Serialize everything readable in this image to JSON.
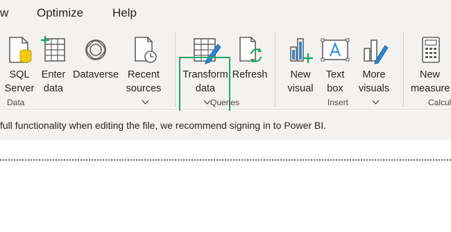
{
  "tabs": [
    "w",
    "Optimize",
    "Help"
  ],
  "ribbon": {
    "data_group": {
      "label": "Data",
      "buttons": [
        {
          "line1": "SQL",
          "line2": "Server",
          "icon": "sql-server-icon"
        },
        {
          "line1": "Enter",
          "line2": "data",
          "icon": "enter-data-icon"
        },
        {
          "line1": "Dataverse",
          "line2": "",
          "icon": "dataverse-icon"
        },
        {
          "line1": "Recent",
          "line2": "sources",
          "icon": "recent-sources-icon",
          "dropdown": true
        }
      ]
    },
    "queries_group": {
      "label": "Queries",
      "buttons": [
        {
          "line1": "Transform",
          "line2": "data",
          "icon": "transform-data-icon",
          "dropdown": true
        },
        {
          "line1": "Refresh",
          "line2": "",
          "icon": "refresh-icon"
        }
      ]
    },
    "insert_group": {
      "label": "Insert",
      "buttons": [
        {
          "line1": "New",
          "line2": "visual",
          "icon": "new-visual-icon"
        },
        {
          "line1": "Text",
          "line2": "box",
          "icon": "text-box-icon"
        },
        {
          "line1": "More",
          "line2": "visuals",
          "icon": "more-visuals-icon",
          "dropdown": true
        }
      ]
    },
    "calc_group": {
      "label": "Calcul",
      "buttons": [
        {
          "line1": "New",
          "line2": "measure",
          "icon": "new-measure-icon"
        }
      ]
    }
  },
  "notice": {
    "text": "full functionality when editing the file, we recommend signing in to Power BI."
  },
  "colors": {
    "accent_green": "#21a366",
    "icon_blue": "#2b88d8",
    "icon_gold": "#f2c811"
  }
}
